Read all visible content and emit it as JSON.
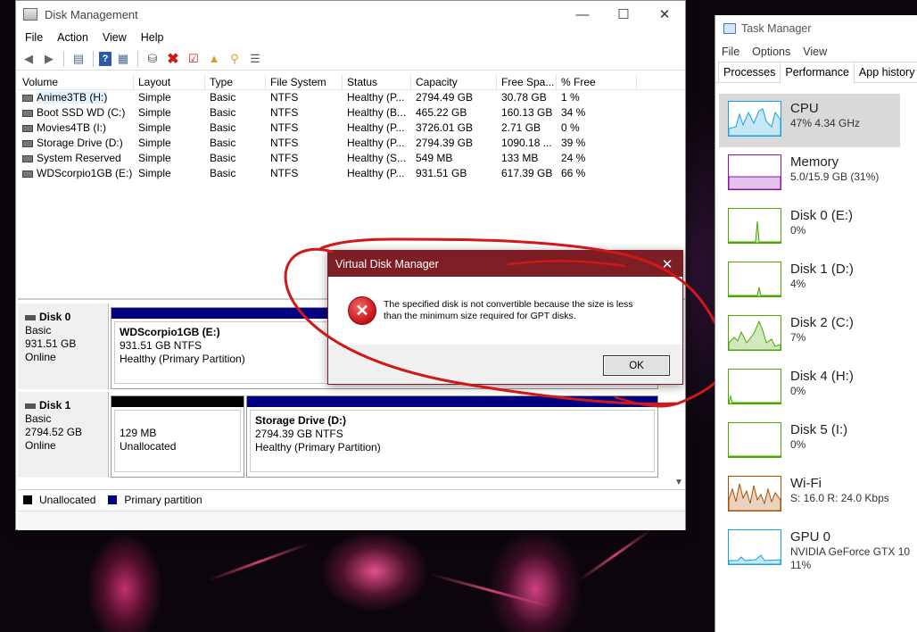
{
  "disk_mgmt": {
    "title": "Disk Management",
    "menu": [
      "File",
      "Action",
      "View",
      "Help"
    ],
    "columns": [
      "Volume",
      "Layout",
      "Type",
      "File System",
      "Status",
      "Capacity",
      "Free Spa...",
      "% Free"
    ],
    "volumes": [
      [
        "Anime3TB (H:)",
        "Simple",
        "Basic",
        "NTFS",
        "Healthy (P...",
        "2794.49 GB",
        "30.78 GB",
        "1 %"
      ],
      [
        "Boot SSD WD (C:)",
        "Simple",
        "Basic",
        "NTFS",
        "Healthy (B...",
        "465.22 GB",
        "160.13 GB",
        "34 %"
      ],
      [
        "Movies4TB (I:)",
        "Simple",
        "Basic",
        "NTFS",
        "Healthy (P...",
        "3726.01 GB",
        "2.71 GB",
        "0 %"
      ],
      [
        "Storage Drive (D:)",
        "Simple",
        "Basic",
        "NTFS",
        "Healthy (P...",
        "2794.39 GB",
        "1090.18 ...",
        "39 %"
      ],
      [
        "System Reserved",
        "Simple",
        "Basic",
        "NTFS",
        "Healthy (S...",
        "549 MB",
        "133 MB",
        "24 %"
      ],
      [
        "WDScorpio1GB (E:)",
        "Simple",
        "Basic",
        "NTFS",
        "Healthy (P...",
        "931.51 GB",
        "617.39 GB",
        "66 %"
      ]
    ],
    "disks": [
      {
        "name": "Disk 0",
        "type": "Basic",
        "size": "931.51 GB",
        "state": "Online",
        "partitions": [
          {
            "label": "WDScorpio1GB  (E:)",
            "size": "931.51 GB NTFS",
            "status": "Healthy (Primary Partition)"
          }
        ]
      },
      {
        "name": "Disk 1",
        "type": "Basic",
        "size": "2794.52 GB",
        "state": "Online",
        "partitions": [
          {
            "label": "",
            "size": "129 MB",
            "status": "Unallocated"
          },
          {
            "label": "Storage Drive  (D:)",
            "size": "2794.39 GB NTFS",
            "status": "Healthy (Primary Partition)"
          }
        ]
      }
    ],
    "legend": [
      "Unallocated",
      "Primary partition"
    ]
  },
  "dialog": {
    "title": "Virtual Disk Manager",
    "message_line1": "The specified disk is not convertible because the size is less",
    "message_line2": "than the minimum size required for GPT disks.",
    "ok_label": "OK"
  },
  "task_manager": {
    "title": "Task Manager",
    "menu": [
      "File",
      "Options",
      "View"
    ],
    "tabs": [
      "Processes",
      "Performance",
      "App history",
      "S"
    ],
    "items": [
      {
        "name": "CPU",
        "value": "47% 4.34 GHz"
      },
      {
        "name": "Memory",
        "value": "5.0/15.9 GB (31%)"
      },
      {
        "name": "Disk 0 (E:)",
        "value": "0%"
      },
      {
        "name": "Disk 1 (D:)",
        "value": "4%"
      },
      {
        "name": "Disk 2 (C:)",
        "value": "7%"
      },
      {
        "name": "Disk 4 (H:)",
        "value": "0%"
      },
      {
        "name": "Disk 5 (I:)",
        "value": "0%"
      },
      {
        "name": "Wi-Fi",
        "value": "S: 16.0  R: 24.0 Kbps"
      },
      {
        "name": "GPU 0",
        "value": "NVIDIA GeForce GTX 10",
        "value2": "11%"
      }
    ]
  },
  "colors": {
    "dialog_title": "#7d1e25",
    "primary_partition": "#000080",
    "unallocated": "#000000",
    "annotation": "#d01818",
    "cpu_graph": "#17a1dc",
    "memory_graph": "#8b12ae",
    "disk_graph": "#4da600",
    "wifi_graph": "#a74f01"
  }
}
